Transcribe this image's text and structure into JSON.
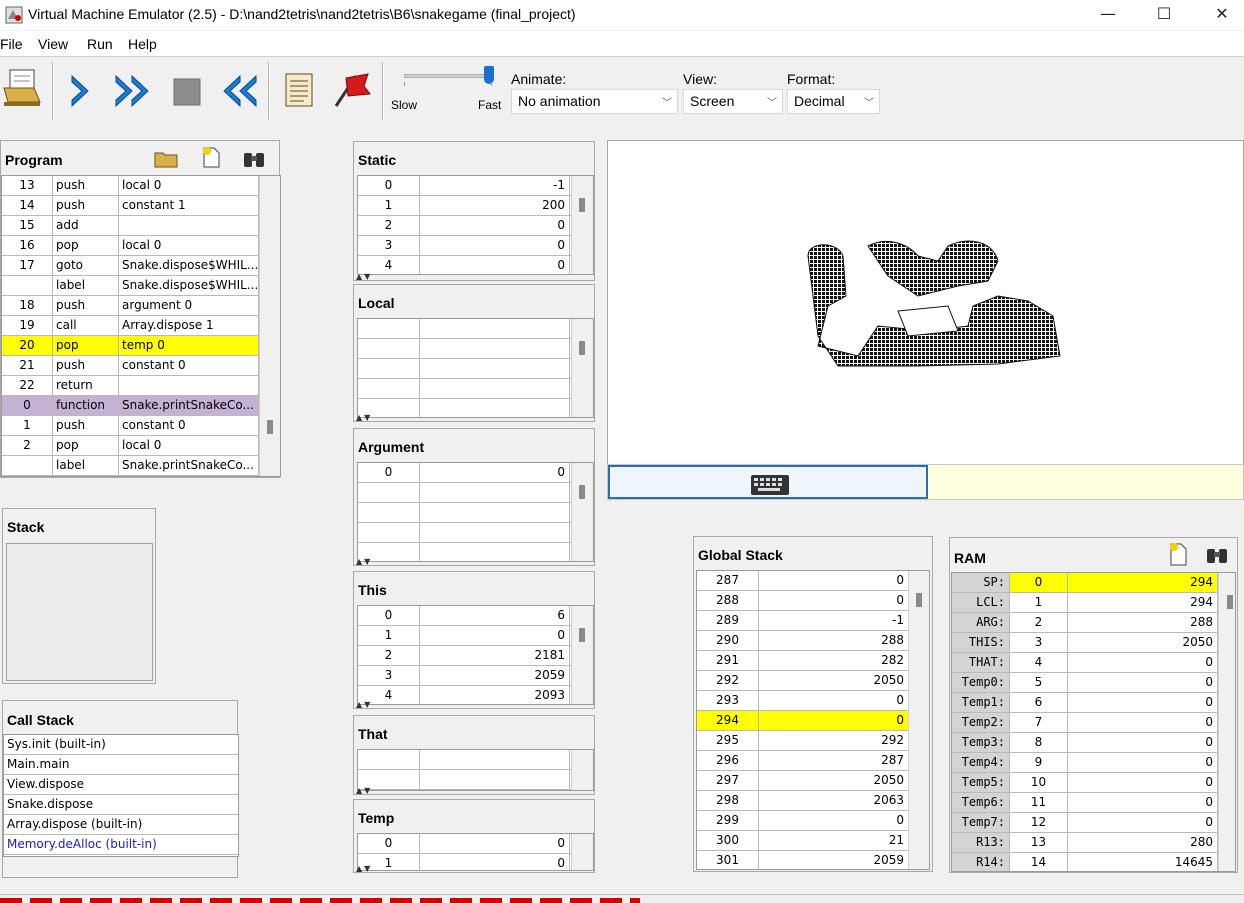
{
  "window": {
    "title": "Virtual Machine Emulator (2.5) - D:\\nand2tetris\\nand2tetris\\B6\\snakegame (final_project)",
    "minimize": "—",
    "maximize": "☐",
    "close": "✕"
  },
  "menu": [
    "File",
    "View",
    "Run",
    "Help"
  ],
  "toolbar": {
    "speed_slow": "Slow",
    "speed_fast": "Fast",
    "animate_label": "Animate:",
    "animate_value": "No animation",
    "view_label": "View:",
    "view_value": "Screen",
    "format_label": "Format:",
    "format_value": "Decimal"
  },
  "program": {
    "title": "Program",
    "rows": [
      {
        "n": "13",
        "cmd": "push",
        "arg": "local 0",
        "hl": ""
      },
      {
        "n": "14",
        "cmd": "push",
        "arg": "constant 1",
        "hl": ""
      },
      {
        "n": "15",
        "cmd": "add",
        "arg": "",
        "hl": ""
      },
      {
        "n": "16",
        "cmd": "pop",
        "arg": "local 0",
        "hl": ""
      },
      {
        "n": "17",
        "cmd": "goto",
        "arg": "Snake.dispose$WHIL...",
        "hl": ""
      },
      {
        "n": "",
        "cmd": "label",
        "arg": "Snake.dispose$WHIL...",
        "hl": ""
      },
      {
        "n": "18",
        "cmd": "push",
        "arg": "argument 0",
        "hl": ""
      },
      {
        "n": "19",
        "cmd": "call",
        "arg": "Array.dispose 1",
        "hl": ""
      },
      {
        "n": "20",
        "cmd": "pop",
        "arg": "temp 0",
        "hl": "yellow"
      },
      {
        "n": "21",
        "cmd": "push",
        "arg": "constant 0",
        "hl": ""
      },
      {
        "n": "22",
        "cmd": "return",
        "arg": "",
        "hl": ""
      },
      {
        "n": "0",
        "cmd": "function",
        "arg": "Snake.printSnakeCo...",
        "hl": "purple"
      },
      {
        "n": "1",
        "cmd": "push",
        "arg": "constant 0",
        "hl": ""
      },
      {
        "n": "2",
        "cmd": "pop",
        "arg": "local 0",
        "hl": ""
      },
      {
        "n": "",
        "cmd": "label",
        "arg": "Snake.printSnakeCo...",
        "hl": ""
      }
    ]
  },
  "stack": {
    "title": "Stack"
  },
  "call_stack": {
    "title": "Call Stack",
    "items": [
      "Sys.init (built-in)",
      "Main.main",
      "View.dispose",
      "Snake.dispose",
      "Array.dispose (built-in)",
      "Memory.deAlloc (built-in)"
    ]
  },
  "static": {
    "title": "Static",
    "rows": [
      [
        "0",
        "-1"
      ],
      [
        "1",
        "200"
      ],
      [
        "2",
        "0"
      ],
      [
        "3",
        "0"
      ],
      [
        "4",
        "0"
      ]
    ]
  },
  "local": {
    "title": "Local",
    "rows": [
      [
        "",
        ""
      ],
      [
        "",
        ""
      ],
      [
        "",
        ""
      ],
      [
        "",
        ""
      ],
      [
        "",
        ""
      ]
    ]
  },
  "argument": {
    "title": "Argument",
    "rows": [
      [
        "0",
        "0"
      ],
      [
        "",
        ""
      ],
      [
        "",
        ""
      ],
      [
        "",
        ""
      ],
      [
        "",
        ""
      ]
    ]
  },
  "this": {
    "title": "This",
    "rows": [
      [
        "0",
        "6"
      ],
      [
        "1",
        "0"
      ],
      [
        "2",
        "2181"
      ],
      [
        "3",
        "2059"
      ],
      [
        "4",
        "2093"
      ]
    ]
  },
  "that": {
    "title": "That",
    "rows": [
      [
        "",
        ""
      ],
      [
        "",
        ""
      ]
    ]
  },
  "temp": {
    "title": "Temp",
    "rows": [
      [
        "0",
        "0"
      ],
      [
        "1",
        "0"
      ]
    ]
  },
  "global_stack": {
    "title": "Global Stack",
    "rows": [
      {
        "a": "287",
        "v": "0",
        "hl": false
      },
      {
        "a": "288",
        "v": "0",
        "hl": false
      },
      {
        "a": "289",
        "v": "-1",
        "hl": false
      },
      {
        "a": "290",
        "v": "288",
        "hl": false
      },
      {
        "a": "291",
        "v": "282",
        "hl": false
      },
      {
        "a": "292",
        "v": "2050",
        "hl": false
      },
      {
        "a": "293",
        "v": "0",
        "hl": false
      },
      {
        "a": "294",
        "v": "0",
        "hl": true
      },
      {
        "a": "295",
        "v": "292",
        "hl": false
      },
      {
        "a": "296",
        "v": "287",
        "hl": false
      },
      {
        "a": "297",
        "v": "2050",
        "hl": false
      },
      {
        "a": "298",
        "v": "2063",
        "hl": false
      },
      {
        "a": "299",
        "v": "0",
        "hl": false
      },
      {
        "a": "300",
        "v": "21",
        "hl": false
      },
      {
        "a": "301",
        "v": "2059",
        "hl": false
      }
    ]
  },
  "ram": {
    "title": "RAM",
    "rows": [
      {
        "label": "SP:",
        "a": "0",
        "v": "294",
        "hl": true
      },
      {
        "label": "LCL:",
        "a": "1",
        "v": "294",
        "hl": false
      },
      {
        "label": "ARG:",
        "a": "2",
        "v": "288",
        "hl": false
      },
      {
        "label": "THIS:",
        "a": "3",
        "v": "2050",
        "hl": false
      },
      {
        "label": "THAT:",
        "a": "4",
        "v": "0",
        "hl": false
      },
      {
        "label": "Temp0:",
        "a": "5",
        "v": "0",
        "hl": false
      },
      {
        "label": "Temp1:",
        "a": "6",
        "v": "0",
        "hl": false
      },
      {
        "label": "Temp2:",
        "a": "7",
        "v": "0",
        "hl": false
      },
      {
        "label": "Temp3:",
        "a": "8",
        "v": "0",
        "hl": false
      },
      {
        "label": "Temp4:",
        "a": "9",
        "v": "0",
        "hl": false
      },
      {
        "label": "Temp5:",
        "a": "10",
        "v": "0",
        "hl": false
      },
      {
        "label": "Temp6:",
        "a": "11",
        "v": "0",
        "hl": false
      },
      {
        "label": "Temp7:",
        "a": "12",
        "v": "0",
        "hl": false
      },
      {
        "label": "R13:",
        "a": "13",
        "v": "280",
        "hl": false
      },
      {
        "label": "R14:",
        "a": "14",
        "v": "14645",
        "hl": false
      }
    ]
  },
  "colors": {
    "highlight": "#ffff00",
    "function_row": "#c4b2d4",
    "link_blue": "#1a1acc",
    "status_red": "#d40000"
  }
}
